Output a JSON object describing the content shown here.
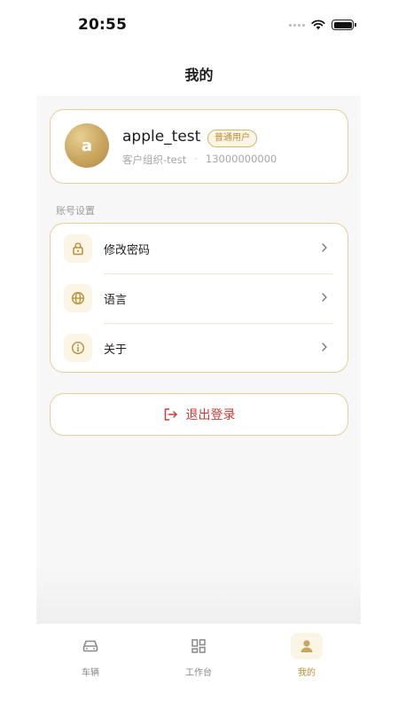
{
  "status_bar": {
    "time": "20:55"
  },
  "header": {
    "title": "我的"
  },
  "profile": {
    "avatar_letter": "a",
    "username": "apple_test",
    "role_badge": "普通用户",
    "organization": "客户组织-test",
    "separator": "·",
    "phone": "13000000000"
  },
  "account_settings": {
    "section_label": "账号设置",
    "items": [
      {
        "label": "修改密码",
        "icon": "lock-icon"
      },
      {
        "label": "语言",
        "icon": "globe-icon"
      },
      {
        "label": "关于",
        "icon": "info-icon"
      }
    ]
  },
  "logout": {
    "label": "退出登录",
    "icon": "logout-icon"
  },
  "tab_bar": {
    "tabs": [
      {
        "label": "车辆",
        "icon": "car-icon",
        "active": false
      },
      {
        "label": "工作台",
        "icon": "dashboard-icon",
        "active": false
      },
      {
        "label": "我的",
        "icon": "person-icon",
        "active": true
      }
    ]
  },
  "colors": {
    "accent_gold": "#c9a55e",
    "badge_text": "#b98d36",
    "logout_red": "#cf3b34",
    "card_border": "#e3cf9b"
  }
}
